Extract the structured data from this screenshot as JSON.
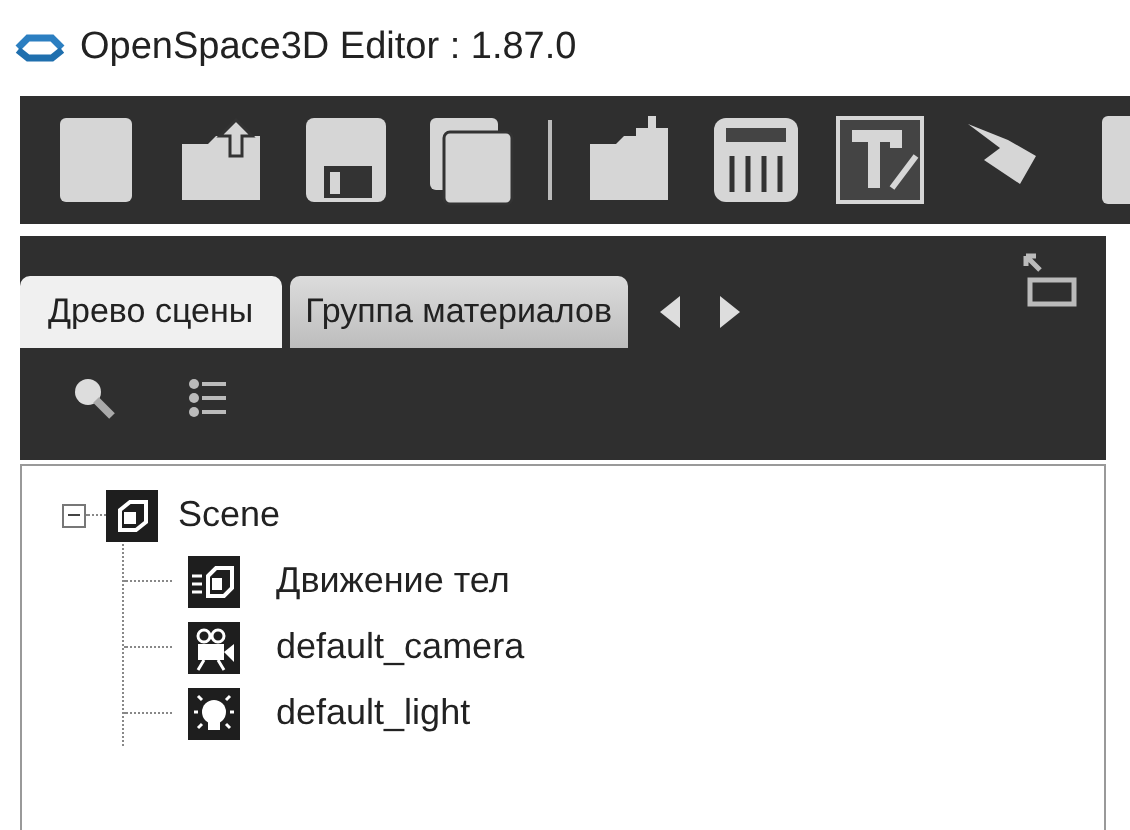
{
  "window": {
    "title": "OpenSpace3D Editor : 1.87.0"
  },
  "tabs": [
    {
      "label": "Древо сцены",
      "selected": true
    },
    {
      "label": "Группа материалов",
      "selected": false
    }
  ],
  "tree": [
    {
      "label": "Scene",
      "kind": "scene",
      "expanded": true,
      "children": [
        {
          "label": "Движение тел",
          "kind": "group"
        },
        {
          "label": "default_camera",
          "kind": "camera"
        },
        {
          "label": "default_light",
          "kind": "light"
        }
      ]
    }
  ]
}
